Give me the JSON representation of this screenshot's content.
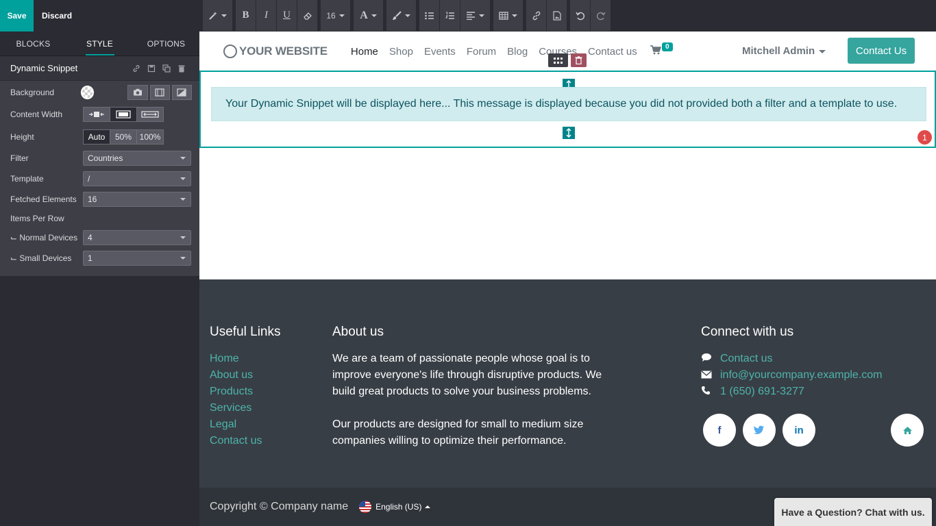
{
  "editor": {
    "save_label": "Save",
    "discard_label": "Discard",
    "tabs": [
      {
        "label": "BLOCKS"
      },
      {
        "label": "STYLE"
      },
      {
        "label": "OPTIONS"
      }
    ],
    "active_tab": "STYLE",
    "snippet_title": "Dynamic Snippet",
    "options": {
      "background_label": "Background",
      "content_width_label": "Content Width",
      "height_label": "Height",
      "height_options": [
        "Auto",
        "50%",
        "100%"
      ],
      "height_selected": "Auto",
      "filter_label": "Filter",
      "filter_value": "Countries",
      "template_label": "Template",
      "template_value": "/",
      "fetched_label": "Fetched Elements",
      "fetched_value": "16",
      "items_per_row_label": "Items Per Row",
      "normal_devices_label": "⌙ Normal Devices",
      "normal_devices_value": "4",
      "small_devices_label": "⌙ Small Devices",
      "small_devices_value": "1"
    }
  },
  "toolbar": {
    "font_size": "16",
    "font_color_label": "A",
    "bold_label": "B",
    "italic_label": "I",
    "underline_label": "U"
  },
  "site": {
    "logo_text": "YOUR WEBSITE",
    "nav": [
      "Home",
      "Shop",
      "Events",
      "Forum",
      "Blog",
      "Courses",
      "Contact us"
    ],
    "active_nav": "Home",
    "cart_count": "0",
    "user_name": "Mitchell Admin",
    "contact_button": "Contact Us",
    "snippet_message": "Your Dynamic Snippet will be displayed here... This message is displayed because you did not provided both a filter and a template to use.",
    "notification_count": "1"
  },
  "footer": {
    "useful_links_title": "Useful Links",
    "useful_links": [
      "Home",
      "About us",
      "Products",
      "Services",
      "Legal",
      "Contact us"
    ],
    "about_title": "About us",
    "about_p1": "We are a team of passionate people whose goal is to improve everyone's life through disruptive products. We build great products to solve your business problems.",
    "about_p2": "Our products are designed for small to medium size companies willing to optimize their performance.",
    "connect_title": "Connect with us",
    "contact_link": "Contact us",
    "email": "info@yourcompany.example.com",
    "phone": "1 (650) 691-3277",
    "social": [
      {
        "label": "f",
        "color": "#3b5998"
      },
      {
        "label": "🐦",
        "color": "#55acee"
      },
      {
        "label": "in",
        "color": "#0976b4"
      }
    ],
    "copyright": "Copyright © Company name",
    "language": "English (US)",
    "chat_label": "Have a Question? Chat with us."
  },
  "colors": {
    "accent": "#00a09d",
    "link": "#4db4ac",
    "footer_bg": "#383e45",
    "panel_bg": "#2b2b33"
  }
}
